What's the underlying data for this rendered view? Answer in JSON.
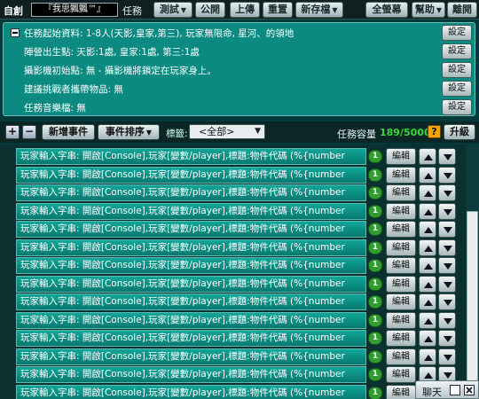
{
  "colors": {
    "background": "#003a3a",
    "panel": "#0a8a80",
    "row": "#0a8f84",
    "capacity": "#37d737",
    "help": "#f2a400",
    "badge": "#2f9e2f"
  },
  "topbar": {
    "mode_label": "自創",
    "title_field": "『我思飄飄™』",
    "mission_word": "任務",
    "buttons": {
      "test": "測試",
      "public": "公開",
      "upload": "上傳",
      "reset": "重置",
      "new_save": "新存檔",
      "all_save": "全螢幕",
      "help": "幫助",
      "leave": "離開"
    }
  },
  "settings_panel": {
    "rows": [
      {
        "text": "任務起始資料: 1-8人(天影,皇家,第三), 玩家無限命, 星河、的領地",
        "button": "設定"
      },
      {
        "text": "陣營出生點: 天影:1處, 皇家:1處, 第三:1處",
        "button": "設定"
      },
      {
        "text": "攝影機初始點: 無 - 攝影機將鎖定在玩家身上。",
        "button": "設定"
      },
      {
        "text": "建議挑戰者攜帶物品: 無",
        "button": "設定"
      },
      {
        "text": "任務音樂檔: 無",
        "button": "設定"
      }
    ]
  },
  "toolbar": {
    "add_symbol": "+",
    "remove_symbol": "−",
    "new_event": "新增事件",
    "event_sort": "事件排序",
    "tag_label": "標籤:",
    "tag_value": "<全部>",
    "capacity_label": "任務容量",
    "capacity_value": "189/5000",
    "help_symbol": "?",
    "upgrade": "升級"
  },
  "events": {
    "rows": [
      {
        "text": "玩家輸入字串: 開啟[Console],玩家[變數/player],標題:物件代碼 (%{number",
        "badge": "1",
        "edit": "編輯"
      },
      {
        "text": "玩家輸入字串: 開啟[Console],玩家[變數/player],標題:物件代碼 (%{number",
        "badge": "1",
        "edit": "編輯"
      },
      {
        "text": "玩家輸入字串: 開啟[Console],玩家[變數/player],標題:物件代碼 (%{number",
        "badge": "1",
        "edit": "編輯"
      },
      {
        "text": "玩家輸入字串: 開啟[Console],玩家[變數/player],標題:物件代碼 (%{number",
        "badge": "1",
        "edit": "編輯"
      },
      {
        "text": "玩家輸入字串: 開啟[Console],玩家[變數/player],標題:物件代碼 (%{number",
        "badge": "1",
        "edit": "編輯"
      },
      {
        "text": "玩家輸入字串: 開啟[Console],玩家[變數/player],標題:物件代碼 (%{number",
        "badge": "1",
        "edit": "編輯"
      },
      {
        "text": "玩家輸入字串: 開啟[Console],玩家[變數/player],標題:物件代碼 (%{number",
        "badge": "1",
        "edit": "編輯"
      },
      {
        "text": "玩家輸入字串: 開啟[Console],玩家[變數/player],標題:物件代碼 (%{number",
        "badge": "1",
        "edit": "編輯"
      },
      {
        "text": "玩家輸入字串: 開啟[Console],玩家[變數/player],標題:物件代碼 (%{number",
        "badge": "1",
        "edit": "編輯"
      },
      {
        "text": "玩家輸入字串: 開啟[Console],玩家[變數/player],標題:物件代碼 (%{number",
        "badge": "1",
        "edit": "編輯"
      },
      {
        "text": "玩家輸入字串: 開啟[Console],玩家[變數/player],標題:物件代碼 (%{number",
        "badge": "1",
        "edit": "編輯"
      },
      {
        "text": "玩家輸入字串: 開啟[Console],玩家[變數/player],標題:物件代碼 (%{number",
        "badge": "1",
        "edit": "編輯"
      },
      {
        "text": "玩家輸入字串: 開啟[Console],玩家[變數/player],標題:物件代碼 (%{number",
        "badge": "1",
        "edit": "編輯"
      },
      {
        "text": "玩家輸入字串: 開啟[Console],玩家[變數/player],標題:物件代碼 (%{number",
        "badge": "1",
        "edit": "編輯"
      }
    ]
  },
  "popup": {
    "label": "聊天"
  }
}
